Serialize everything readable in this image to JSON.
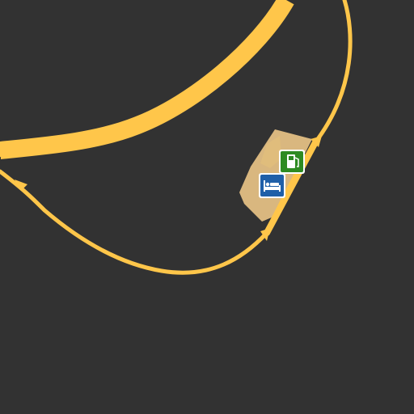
{
  "map": {
    "background_color": "#323232",
    "road_color": "#ffc64a",
    "rest_area_fill": "#d9b77f",
    "rest_area_patch": "#e4c27a",
    "pois": [
      {
        "icon": "fuel-station-icon",
        "bg_color": "#2e8b22",
        "glyph_color": "#ffffff"
      },
      {
        "icon": "hotel-bed-icon",
        "bg_color": "#1f5fa8",
        "glyph_color": "#ffffff"
      }
    ]
  }
}
